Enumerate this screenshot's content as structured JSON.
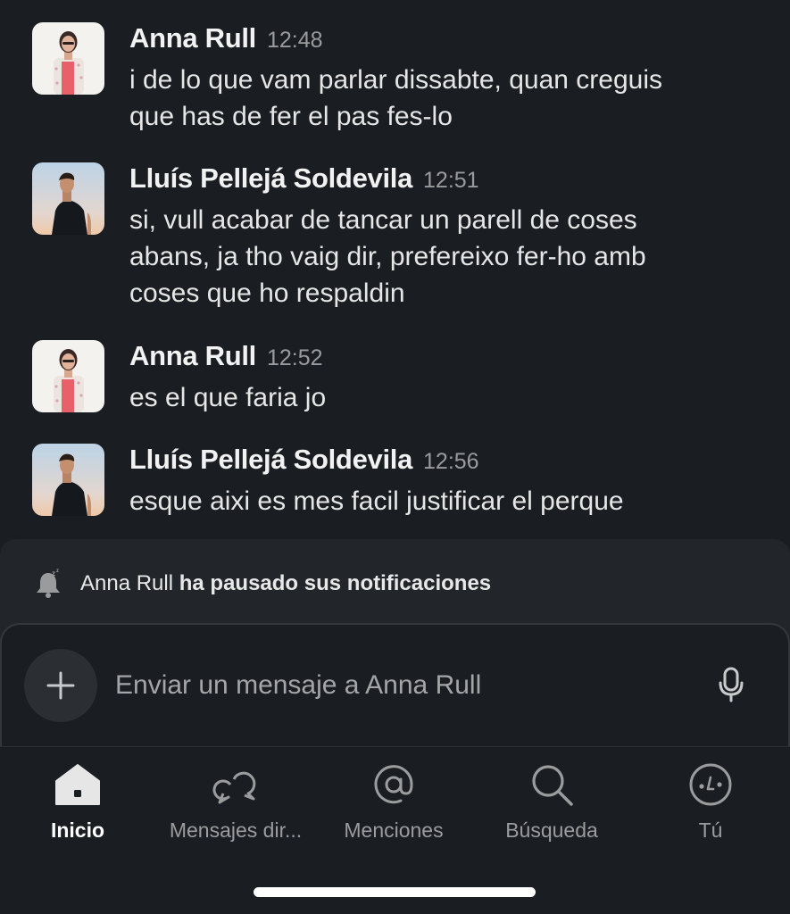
{
  "messages": [
    {
      "author": "Anna Rull",
      "time": "12:48",
      "lines": [
        "i de lo que vam parlar dissabte, quan creguis",
        "que has de fer el pas fes-lo"
      ],
      "avatar": "anna-avatar"
    },
    {
      "author": "Lluís Pellejá Soldevila",
      "time": "12:51",
      "lines": [
        "si, vull acabar de tancar un parell de coses",
        "abans, ja tho vaig dir, prefereixo fer-ho amb",
        "coses que ho respaldin"
      ],
      "avatar": "lluis-avatar"
    },
    {
      "author": "Anna Rull",
      "time": "12:52",
      "lines": [
        "es el que faria jo"
      ],
      "avatar": "anna-avatar"
    },
    {
      "author": "Lluís Pellejá Soldevila",
      "time": "12:56",
      "lines": [
        "esque aixi es mes facil justificar el perque"
      ],
      "avatar": "lluis-avatar"
    }
  ],
  "notice": {
    "name": "Anna Rull",
    "action": "ha pausado sus notificaciones",
    "icon": "bell-snooze-icon"
  },
  "composer": {
    "placeholder": "Enviar un mensaje a Anna Rull",
    "add_icon": "plus-icon",
    "mic_icon": "microphone-icon"
  },
  "tabs": [
    {
      "label": "Inicio",
      "icon": "home-icon",
      "active": true
    },
    {
      "label": "Mensajes dir...",
      "icon": "direct-messages-icon",
      "active": false
    },
    {
      "label": "Menciones",
      "icon": "at-sign-icon",
      "active": false
    },
    {
      "label": "Búsqueda",
      "icon": "search-icon",
      "active": false
    },
    {
      "label": "Tú",
      "icon": "profile-face-icon",
      "active": false
    }
  ],
  "colors": {
    "background": "#1a1d21",
    "panel": "#222529",
    "muted_text": "#9b9c9e",
    "active_tab": "#ffffff"
  }
}
